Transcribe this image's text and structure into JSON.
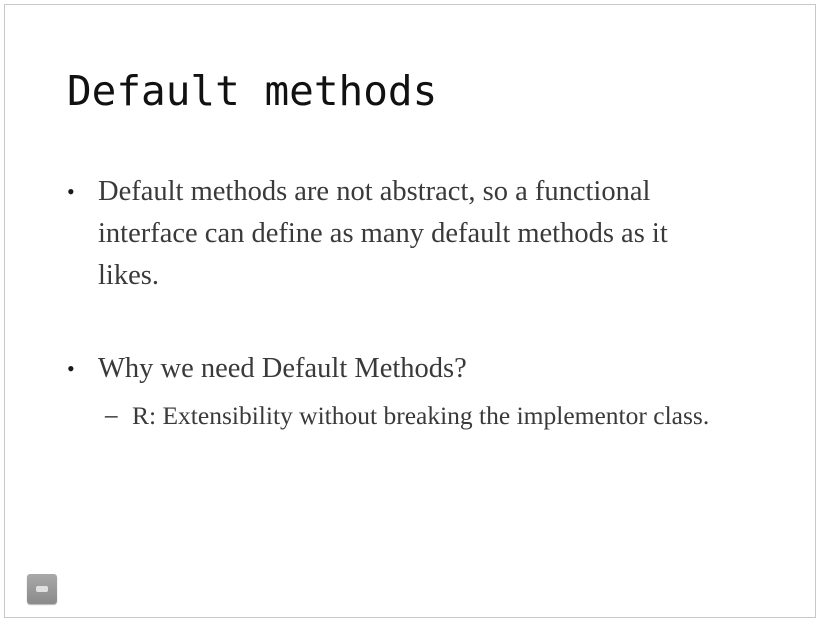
{
  "slide": {
    "title": "Default methods",
    "bullets": [
      {
        "marker": "•",
        "text": "Default methods are not abstract, so a functional interface can define as many default methods as it likes."
      },
      {
        "marker": "•",
        "text": "Why we need Default Methods?",
        "sub_items": [
          {
            "marker": "–",
            "text": "R: Extensibility without breaking the implementor class."
          }
        ]
      }
    ],
    "footer_icon": "slide-icon"
  }
}
